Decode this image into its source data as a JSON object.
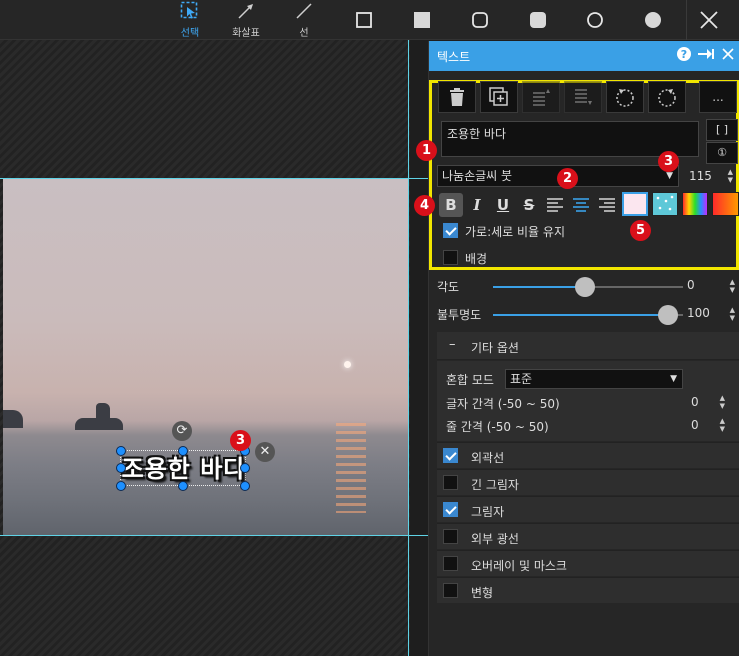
{
  "toolbar": {
    "tools": [
      {
        "name": "select",
        "label": "선택"
      },
      {
        "name": "arrow",
        "label": "화살표"
      },
      {
        "name": "line",
        "label": "선"
      }
    ]
  },
  "canvas": {
    "text_object": "조용한 바다"
  },
  "panel": {
    "title": "텍스트",
    "text_content": "조용한 바다",
    "bracket_btn": "[ ]",
    "info_btn": "①",
    "more_btn": "...",
    "font_name": "나눔손글씨 붓",
    "font_size": "115",
    "keep_ratio_label": "가로:세로 비율 유지",
    "background_label": "배경",
    "angle_label": "각도",
    "angle_value": "0",
    "opacity_label": "불투명도",
    "opacity_value": "100",
    "other_options": "기타 옵션",
    "blend_label": "혼합 모드",
    "blend_value": "표준",
    "letter_spacing_label": "글자 간격 (-50 ~ 50)",
    "letter_spacing_value": "0",
    "line_spacing_label": "줄 간격 (-50 ~ 50)",
    "line_spacing_value": "0",
    "options": [
      {
        "label": "외곽선",
        "checked": true
      },
      {
        "label": "긴 그림자",
        "checked": false
      },
      {
        "label": "그림자",
        "checked": true
      },
      {
        "label": "외부 광선",
        "checked": false
      },
      {
        "label": "오버레이 및 마스크",
        "checked": false
      },
      {
        "label": "변형",
        "checked": false
      }
    ],
    "keep_ratio_checked": true,
    "background_checked": false,
    "opacity_fraction": 1.0,
    "angle_fraction": 0.5
  },
  "badges": [
    "1",
    "2",
    "3",
    "4",
    "5",
    "3"
  ],
  "colors": {
    "accent": "#3aa0e6",
    "highlight": "#f2e600",
    "badge": "#d9101a",
    "guide": "#5fd3e6"
  }
}
